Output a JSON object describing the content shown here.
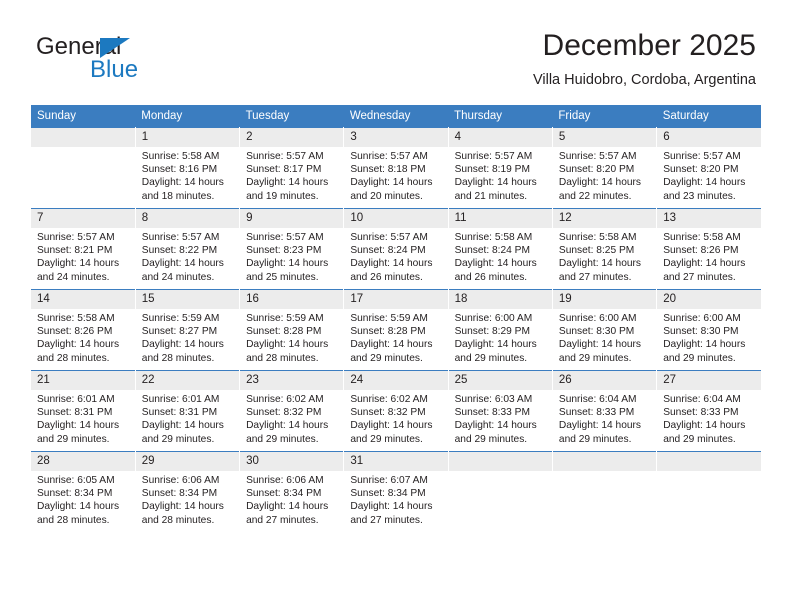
{
  "brand": {
    "name_top": "General",
    "name_bottom": "Blue",
    "triangle_color": "#1c79c0",
    "text_color": "#231f20"
  },
  "header": {
    "title": "December 2025",
    "subtitle": "Villa Huidobro, Cordoba, Argentina"
  },
  "theme": {
    "header_bg": "#3b7dc0",
    "header_text": "#ffffff",
    "daynum_bg": "#ececec",
    "cell_bg": "#ffffff",
    "text": "#231f20"
  },
  "calendar": {
    "weekday_headers": [
      "Sunday",
      "Monday",
      "Tuesday",
      "Wednesday",
      "Thursday",
      "Friday",
      "Saturday"
    ],
    "weeks": [
      [
        {
          "day": "",
          "lines": []
        },
        {
          "day": "1",
          "lines": [
            "Sunrise: 5:58 AM",
            "Sunset: 8:16 PM",
            "Daylight: 14 hours",
            "and 18 minutes."
          ]
        },
        {
          "day": "2",
          "lines": [
            "Sunrise: 5:57 AM",
            "Sunset: 8:17 PM",
            "Daylight: 14 hours",
            "and 19 minutes."
          ]
        },
        {
          "day": "3",
          "lines": [
            "Sunrise: 5:57 AM",
            "Sunset: 8:18 PM",
            "Daylight: 14 hours",
            "and 20 minutes."
          ]
        },
        {
          "day": "4",
          "lines": [
            "Sunrise: 5:57 AM",
            "Sunset: 8:19 PM",
            "Daylight: 14 hours",
            "and 21 minutes."
          ]
        },
        {
          "day": "5",
          "lines": [
            "Sunrise: 5:57 AM",
            "Sunset: 8:20 PM",
            "Daylight: 14 hours",
            "and 22 minutes."
          ]
        },
        {
          "day": "6",
          "lines": [
            "Sunrise: 5:57 AM",
            "Sunset: 8:20 PM",
            "Daylight: 14 hours",
            "and 23 minutes."
          ]
        }
      ],
      [
        {
          "day": "7",
          "lines": [
            "Sunrise: 5:57 AM",
            "Sunset: 8:21 PM",
            "Daylight: 14 hours",
            "and 24 minutes."
          ]
        },
        {
          "day": "8",
          "lines": [
            "Sunrise: 5:57 AM",
            "Sunset: 8:22 PM",
            "Daylight: 14 hours",
            "and 24 minutes."
          ]
        },
        {
          "day": "9",
          "lines": [
            "Sunrise: 5:57 AM",
            "Sunset: 8:23 PM",
            "Daylight: 14 hours",
            "and 25 minutes."
          ]
        },
        {
          "day": "10",
          "lines": [
            "Sunrise: 5:57 AM",
            "Sunset: 8:24 PM",
            "Daylight: 14 hours",
            "and 26 minutes."
          ]
        },
        {
          "day": "11",
          "lines": [
            "Sunrise: 5:58 AM",
            "Sunset: 8:24 PM",
            "Daylight: 14 hours",
            "and 26 minutes."
          ]
        },
        {
          "day": "12",
          "lines": [
            "Sunrise: 5:58 AM",
            "Sunset: 8:25 PM",
            "Daylight: 14 hours",
            "and 27 minutes."
          ]
        },
        {
          "day": "13",
          "lines": [
            "Sunrise: 5:58 AM",
            "Sunset: 8:26 PM",
            "Daylight: 14 hours",
            "and 27 minutes."
          ]
        }
      ],
      [
        {
          "day": "14",
          "lines": [
            "Sunrise: 5:58 AM",
            "Sunset: 8:26 PM",
            "Daylight: 14 hours",
            "and 28 minutes."
          ]
        },
        {
          "day": "15",
          "lines": [
            "Sunrise: 5:59 AM",
            "Sunset: 8:27 PM",
            "Daylight: 14 hours",
            "and 28 minutes."
          ]
        },
        {
          "day": "16",
          "lines": [
            "Sunrise: 5:59 AM",
            "Sunset: 8:28 PM",
            "Daylight: 14 hours",
            "and 28 minutes."
          ]
        },
        {
          "day": "17",
          "lines": [
            "Sunrise: 5:59 AM",
            "Sunset: 8:28 PM",
            "Daylight: 14 hours",
            "and 29 minutes."
          ]
        },
        {
          "day": "18",
          "lines": [
            "Sunrise: 6:00 AM",
            "Sunset: 8:29 PM",
            "Daylight: 14 hours",
            "and 29 minutes."
          ]
        },
        {
          "day": "19",
          "lines": [
            "Sunrise: 6:00 AM",
            "Sunset: 8:30 PM",
            "Daylight: 14 hours",
            "and 29 minutes."
          ]
        },
        {
          "day": "20",
          "lines": [
            "Sunrise: 6:00 AM",
            "Sunset: 8:30 PM",
            "Daylight: 14 hours",
            "and 29 minutes."
          ]
        }
      ],
      [
        {
          "day": "21",
          "lines": [
            "Sunrise: 6:01 AM",
            "Sunset: 8:31 PM",
            "Daylight: 14 hours",
            "and 29 minutes."
          ]
        },
        {
          "day": "22",
          "lines": [
            "Sunrise: 6:01 AM",
            "Sunset: 8:31 PM",
            "Daylight: 14 hours",
            "and 29 minutes."
          ]
        },
        {
          "day": "23",
          "lines": [
            "Sunrise: 6:02 AM",
            "Sunset: 8:32 PM",
            "Daylight: 14 hours",
            "and 29 minutes."
          ]
        },
        {
          "day": "24",
          "lines": [
            "Sunrise: 6:02 AM",
            "Sunset: 8:32 PM",
            "Daylight: 14 hours",
            "and 29 minutes."
          ]
        },
        {
          "day": "25",
          "lines": [
            "Sunrise: 6:03 AM",
            "Sunset: 8:33 PM",
            "Daylight: 14 hours",
            "and 29 minutes."
          ]
        },
        {
          "day": "26",
          "lines": [
            "Sunrise: 6:04 AM",
            "Sunset: 8:33 PM",
            "Daylight: 14 hours",
            "and 29 minutes."
          ]
        },
        {
          "day": "27",
          "lines": [
            "Sunrise: 6:04 AM",
            "Sunset: 8:33 PM",
            "Daylight: 14 hours",
            "and 29 minutes."
          ]
        }
      ],
      [
        {
          "day": "28",
          "lines": [
            "Sunrise: 6:05 AM",
            "Sunset: 8:34 PM",
            "Daylight: 14 hours",
            "and 28 minutes."
          ]
        },
        {
          "day": "29",
          "lines": [
            "Sunrise: 6:06 AM",
            "Sunset: 8:34 PM",
            "Daylight: 14 hours",
            "and 28 minutes."
          ]
        },
        {
          "day": "30",
          "lines": [
            "Sunrise: 6:06 AM",
            "Sunset: 8:34 PM",
            "Daylight: 14 hours",
            "and 27 minutes."
          ]
        },
        {
          "day": "31",
          "lines": [
            "Sunrise: 6:07 AM",
            "Sunset: 8:34 PM",
            "Daylight: 14 hours",
            "and 27 minutes."
          ]
        },
        {
          "day": "",
          "lines": []
        },
        {
          "day": "",
          "lines": []
        },
        {
          "day": "",
          "lines": []
        }
      ]
    ]
  }
}
